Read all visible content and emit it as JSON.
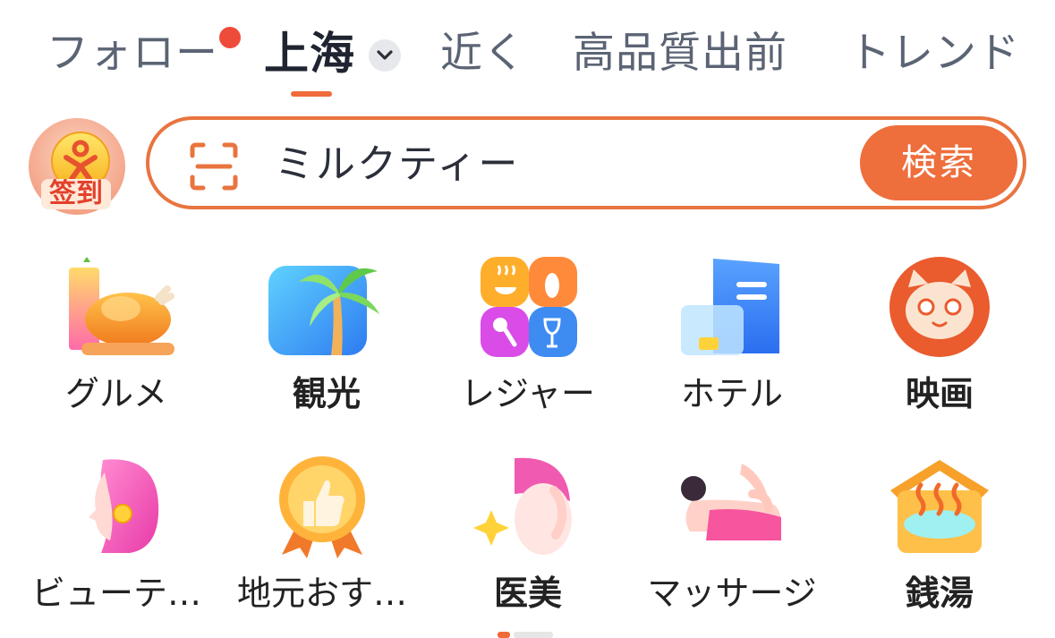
{
  "tabs": {
    "follow": "フォロー",
    "city": "上海",
    "nearby": "近く",
    "high_quality": "高品質出前",
    "trend": "トレンド"
  },
  "checkin": {
    "label": "签到"
  },
  "search": {
    "query": "ミルクティー",
    "button": "検索"
  },
  "categories": [
    {
      "label": "グルメ",
      "icon": "roast-chicken-icon"
    },
    {
      "label": "観光",
      "icon": "palm-tree-icon"
    },
    {
      "label": "レジャー",
      "icon": "leisure-grid-icon"
    },
    {
      "label": "ホテル",
      "icon": "hotel-door-icon"
    },
    {
      "label": "映画",
      "icon": "cat-face-icon"
    },
    {
      "label": "ビューテ…",
      "icon": "beauty-face-icon"
    },
    {
      "label": "地元おす…",
      "icon": "thumbs-up-medal-icon"
    },
    {
      "label": "医美",
      "icon": "facial-care-icon"
    },
    {
      "label": "マッサージ",
      "icon": "massage-icon"
    },
    {
      "label": "銭湯",
      "icon": "hot-spring-icon"
    }
  ],
  "colors": {
    "accent": "#ee6e3c",
    "notify": "#ef4b3a"
  }
}
